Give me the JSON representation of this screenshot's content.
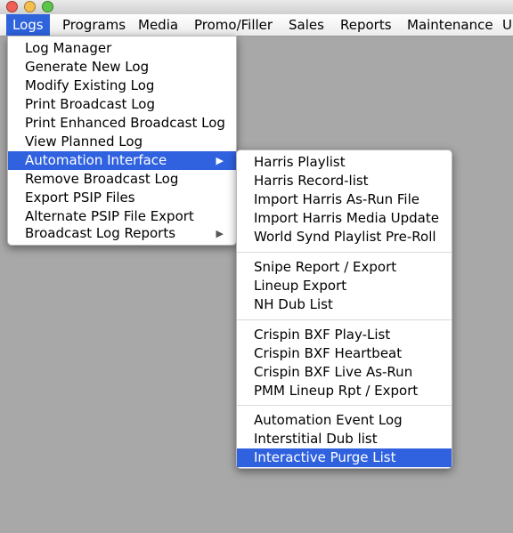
{
  "window": {
    "traffic_lights": [
      {
        "name": "close-button",
        "color": "#ee5f57"
      },
      {
        "name": "minimize-button",
        "color": "#f4bf4f"
      },
      {
        "name": "zoom-button",
        "color": "#5cc44b"
      }
    ]
  },
  "menubar": {
    "items": [
      "Logs",
      "Programs",
      "Media",
      "Promo/Filler",
      "Sales",
      "Reports",
      "Maintenance",
      "U"
    ]
  },
  "logs_menu": {
    "items": [
      "Log Manager",
      "Generate New Log",
      "Modify Existing Log",
      "Print Broadcast Log",
      "Print Enhanced Broadcast Log",
      "View Planned Log",
      "Automation Interface",
      "Remove Broadcast Log",
      "Export PSIP Files",
      "Alternate PSIP File Export",
      "Broadcast Log Reports"
    ],
    "submenu_arrow": "▶"
  },
  "automation_submenu": {
    "groups": [
      [
        "Harris Playlist",
        "Harris Record-list",
        "Import Harris As-Run File",
        "Import Harris Media Update",
        "World Synd Playlist Pre-Roll"
      ],
      [
        "Snipe Report / Export",
        "Lineup Export",
        "NH Dub List"
      ],
      [
        "Crispin BXF Play-List",
        "Crispin BXF Heartbeat",
        "Crispin BXF Live As-Run",
        "PMM Lineup Rpt / Export"
      ],
      [
        "Automation Event Log",
        "Interstitial Dub list",
        "Interactive Purge List"
      ]
    ]
  },
  "colors": {
    "highlight": "#3062e0",
    "background": "#a8a8a8"
  }
}
